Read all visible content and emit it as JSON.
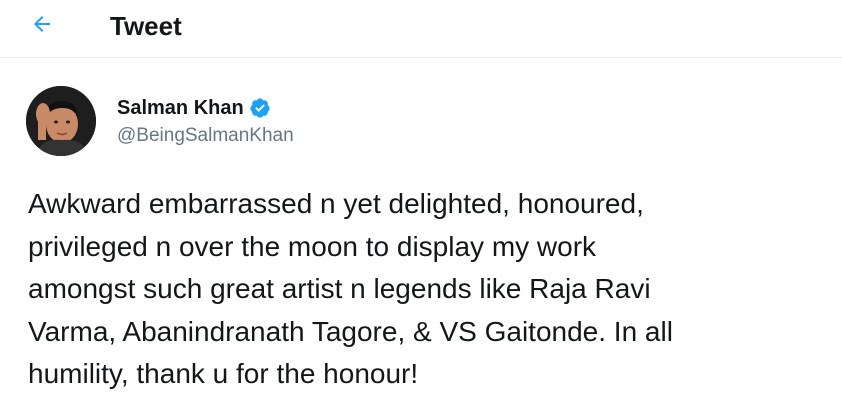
{
  "header": {
    "title": "Tweet",
    "back_icon": "arrow-left-icon",
    "accent_color": "#1da1f2"
  },
  "author": {
    "name": "Salman Khan",
    "handle": "@BeingSalmanKhan",
    "verified": true,
    "verified_icon": "verified-badge-icon",
    "verified_color": "#1da1f2"
  },
  "tweet": {
    "text": "Awkward embarrassed n yet delighted, honoured,\nprivileged n over the moon to display my work\namongst such great artist n legends like Raja Ravi\nVarma, Abanindranath Tagore, & VS Gaitonde. In all\nhumility, thank u for the honour!"
  }
}
